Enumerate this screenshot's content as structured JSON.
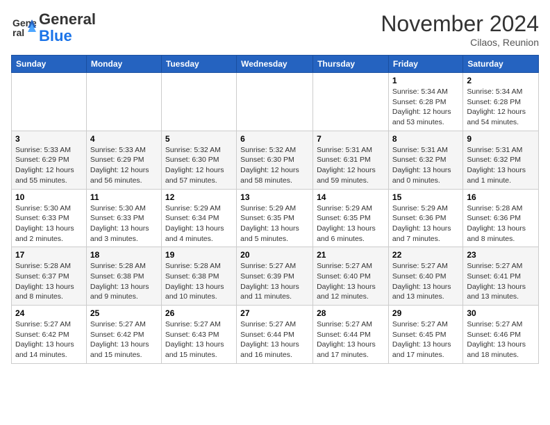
{
  "header": {
    "logo_line1": "General",
    "logo_line2": "Blue",
    "month_title": "November 2024",
    "subtitle": "Cilaos, Reunion"
  },
  "weekdays": [
    "Sunday",
    "Monday",
    "Tuesday",
    "Wednesday",
    "Thursday",
    "Friday",
    "Saturday"
  ],
  "weeks": [
    [
      {
        "day": "",
        "info": ""
      },
      {
        "day": "",
        "info": ""
      },
      {
        "day": "",
        "info": ""
      },
      {
        "day": "",
        "info": ""
      },
      {
        "day": "",
        "info": ""
      },
      {
        "day": "1",
        "info": "Sunrise: 5:34 AM\nSunset: 6:28 PM\nDaylight: 12 hours\nand 53 minutes."
      },
      {
        "day": "2",
        "info": "Sunrise: 5:34 AM\nSunset: 6:28 PM\nDaylight: 12 hours\nand 54 minutes."
      }
    ],
    [
      {
        "day": "3",
        "info": "Sunrise: 5:33 AM\nSunset: 6:29 PM\nDaylight: 12 hours\nand 55 minutes."
      },
      {
        "day": "4",
        "info": "Sunrise: 5:33 AM\nSunset: 6:29 PM\nDaylight: 12 hours\nand 56 minutes."
      },
      {
        "day": "5",
        "info": "Sunrise: 5:32 AM\nSunset: 6:30 PM\nDaylight: 12 hours\nand 57 minutes."
      },
      {
        "day": "6",
        "info": "Sunrise: 5:32 AM\nSunset: 6:30 PM\nDaylight: 12 hours\nand 58 minutes."
      },
      {
        "day": "7",
        "info": "Sunrise: 5:31 AM\nSunset: 6:31 PM\nDaylight: 12 hours\nand 59 minutes."
      },
      {
        "day": "8",
        "info": "Sunrise: 5:31 AM\nSunset: 6:32 PM\nDaylight: 13 hours\nand 0 minutes."
      },
      {
        "day": "9",
        "info": "Sunrise: 5:31 AM\nSunset: 6:32 PM\nDaylight: 13 hours\nand 1 minute."
      }
    ],
    [
      {
        "day": "10",
        "info": "Sunrise: 5:30 AM\nSunset: 6:33 PM\nDaylight: 13 hours\nand 2 minutes."
      },
      {
        "day": "11",
        "info": "Sunrise: 5:30 AM\nSunset: 6:33 PM\nDaylight: 13 hours\nand 3 minutes."
      },
      {
        "day": "12",
        "info": "Sunrise: 5:29 AM\nSunset: 6:34 PM\nDaylight: 13 hours\nand 4 minutes."
      },
      {
        "day": "13",
        "info": "Sunrise: 5:29 AM\nSunset: 6:35 PM\nDaylight: 13 hours\nand 5 minutes."
      },
      {
        "day": "14",
        "info": "Sunrise: 5:29 AM\nSunset: 6:35 PM\nDaylight: 13 hours\nand 6 minutes."
      },
      {
        "day": "15",
        "info": "Sunrise: 5:29 AM\nSunset: 6:36 PM\nDaylight: 13 hours\nand 7 minutes."
      },
      {
        "day": "16",
        "info": "Sunrise: 5:28 AM\nSunset: 6:36 PM\nDaylight: 13 hours\nand 8 minutes."
      }
    ],
    [
      {
        "day": "17",
        "info": "Sunrise: 5:28 AM\nSunset: 6:37 PM\nDaylight: 13 hours\nand 8 minutes."
      },
      {
        "day": "18",
        "info": "Sunrise: 5:28 AM\nSunset: 6:38 PM\nDaylight: 13 hours\nand 9 minutes."
      },
      {
        "day": "19",
        "info": "Sunrise: 5:28 AM\nSunset: 6:38 PM\nDaylight: 13 hours\nand 10 minutes."
      },
      {
        "day": "20",
        "info": "Sunrise: 5:27 AM\nSunset: 6:39 PM\nDaylight: 13 hours\nand 11 minutes."
      },
      {
        "day": "21",
        "info": "Sunrise: 5:27 AM\nSunset: 6:40 PM\nDaylight: 13 hours\nand 12 minutes."
      },
      {
        "day": "22",
        "info": "Sunrise: 5:27 AM\nSunset: 6:40 PM\nDaylight: 13 hours\nand 13 minutes."
      },
      {
        "day": "23",
        "info": "Sunrise: 5:27 AM\nSunset: 6:41 PM\nDaylight: 13 hours\nand 13 minutes."
      }
    ],
    [
      {
        "day": "24",
        "info": "Sunrise: 5:27 AM\nSunset: 6:42 PM\nDaylight: 13 hours\nand 14 minutes."
      },
      {
        "day": "25",
        "info": "Sunrise: 5:27 AM\nSunset: 6:42 PM\nDaylight: 13 hours\nand 15 minutes."
      },
      {
        "day": "26",
        "info": "Sunrise: 5:27 AM\nSunset: 6:43 PM\nDaylight: 13 hours\nand 15 minutes."
      },
      {
        "day": "27",
        "info": "Sunrise: 5:27 AM\nSunset: 6:44 PM\nDaylight: 13 hours\nand 16 minutes."
      },
      {
        "day": "28",
        "info": "Sunrise: 5:27 AM\nSunset: 6:44 PM\nDaylight: 13 hours\nand 17 minutes."
      },
      {
        "day": "29",
        "info": "Sunrise: 5:27 AM\nSunset: 6:45 PM\nDaylight: 13 hours\nand 17 minutes."
      },
      {
        "day": "30",
        "info": "Sunrise: 5:27 AM\nSunset: 6:46 PM\nDaylight: 13 hours\nand 18 minutes."
      }
    ]
  ]
}
